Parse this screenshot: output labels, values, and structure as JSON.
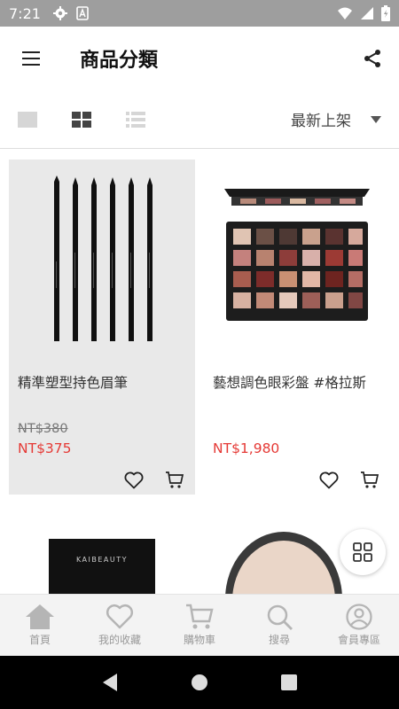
{
  "status_bar": {
    "time": "7:21"
  },
  "app_bar": {
    "title": "商品分類"
  },
  "toolbar": {
    "sort_selected": "最新上架"
  },
  "products": [
    {
      "name": "精準塑型持色眉筆",
      "old_price": "NT$380",
      "price": "NT$375"
    },
    {
      "name": "藝想調色眼彩盤 #格拉斯",
      "old_price": "",
      "price": "NT$1,980"
    },
    {
      "brand_text": "KAIBEAUTY"
    }
  ],
  "bottom_nav": [
    {
      "label": "首頁"
    },
    {
      "label": "我的收藏"
    },
    {
      "label": "購物車"
    },
    {
      "label": "搜尋"
    },
    {
      "label": "會員專區"
    }
  ],
  "colors": {
    "price": "#e53935",
    "nav_icon": "#b5b5b5",
    "status_bar": "#9e9e9e"
  }
}
